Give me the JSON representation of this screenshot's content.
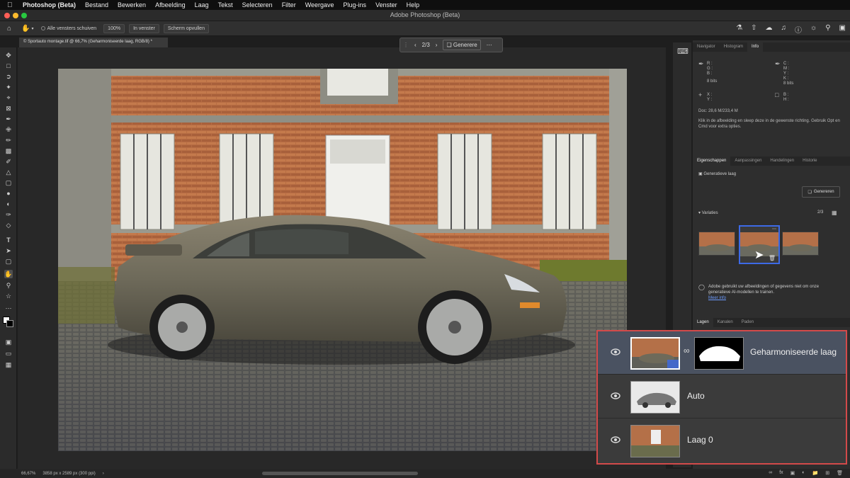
{
  "menubar": {
    "apple": "",
    "items": [
      "Photoshop (Beta)",
      "Bestand",
      "Bewerken",
      "Afbeelding",
      "Laag",
      "Tekst",
      "Selecteren",
      "Filter",
      "Weergave",
      "Plug-ins",
      "Venster",
      "Help"
    ]
  },
  "window": {
    "title": "Adobe Photoshop (Beta)"
  },
  "options_bar": {
    "checkbox_label": "Alle vensters schuiven",
    "zoom_button": "100%",
    "fit_button": "In venster",
    "fill_button": "Scherm opvullen"
  },
  "document": {
    "tab_title": "© Sportauto montage.tif @ 66,7% (Geharmoniseerde laag, RGB/8) *"
  },
  "context_bar": {
    "counter": "2/3",
    "generate_label": "Generere"
  },
  "panels": {
    "top_tabs": [
      "Navigator",
      "Histogram",
      "Info"
    ],
    "info": {
      "rgb": [
        "R :",
        "G :",
        "B :"
      ],
      "cmyk": [
        "C :",
        "M :",
        "Y :",
        "K :"
      ],
      "bits_left": "8 bits",
      "bits_right": "8 bits",
      "xy": [
        "X :",
        "Y :"
      ],
      "bh": [
        "B :",
        "H :"
      ],
      "doc": "Doc: 28,6 M/233,4 M",
      "help": "Klik in de afbeelding en sleep deze in de gewenste richting. Gebruik Opt en Cmd voor extra opties."
    },
    "mid_tabs": [
      "Eigenschappen",
      "Aanpassingen",
      "Handelingen",
      "Historie"
    ],
    "properties": {
      "layer_type": "Generatieve laag",
      "generate_button": "Genereren",
      "variations_label": "Variaties",
      "variations_count": "2/3",
      "notice": "Adobe gebruikt uw afbeeldingen of gegevens niet om onze generatieve AI-modellen te trainen.",
      "more_info": "Meer info"
    },
    "layer_tabs": [
      "Lagen",
      "Kanalen",
      "Paden"
    ]
  },
  "layers": [
    {
      "name": "Geharmoniseerde laag",
      "selected": true
    },
    {
      "name": "Auto",
      "selected": false
    },
    {
      "name": "Laag 0",
      "selected": false
    }
  ],
  "status_bar": {
    "zoom": "66,67%",
    "dimensions": "3858 px x 2589 px (300 ppi)"
  },
  "colors": {
    "accent": "#3d6ae6",
    "highlight_border": "#d34a4a",
    "selected_layer": "#4a5261"
  }
}
